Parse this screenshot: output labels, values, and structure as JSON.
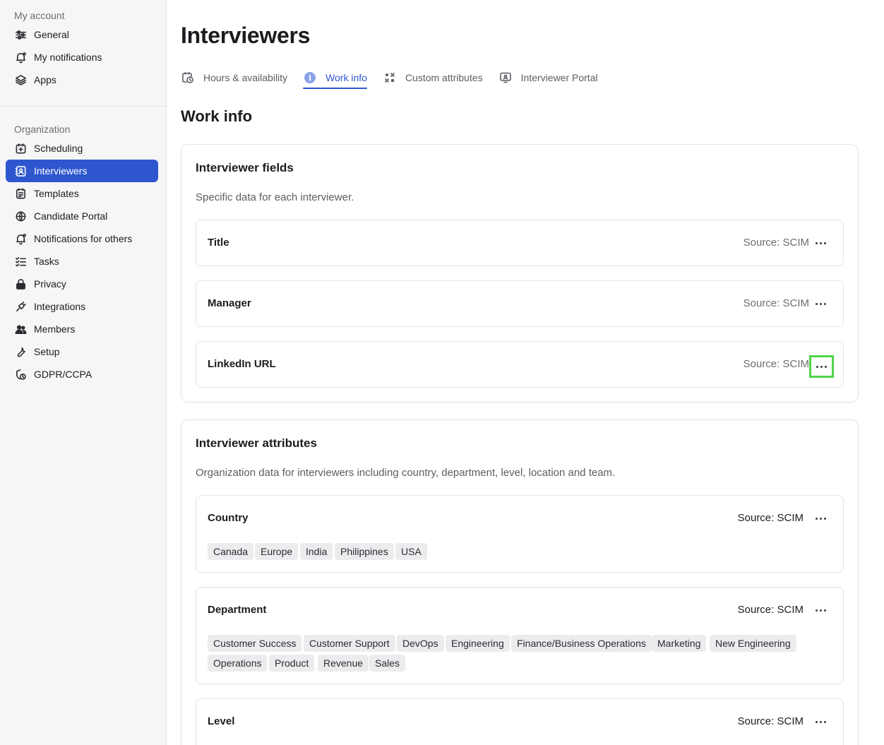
{
  "sidebar": {
    "my_account_title": "My account",
    "my_account_items": [
      {
        "label": "General",
        "icon": "sliders-icon"
      },
      {
        "label": "My notifications",
        "icon": "bell-icon"
      },
      {
        "label": "Apps",
        "icon": "layers-icon"
      }
    ],
    "organization_title": "Organization",
    "organization_items": [
      {
        "label": "Scheduling",
        "icon": "calendar-plus-icon"
      },
      {
        "label": "Interviewers",
        "icon": "contact-card-icon",
        "active": true
      },
      {
        "label": "Templates",
        "icon": "templates-icon"
      },
      {
        "label": "Candidate Portal",
        "icon": "globe-icon"
      },
      {
        "label": "Notifications for others",
        "icon": "bell-icon"
      },
      {
        "label": "Tasks",
        "icon": "checklist-icon"
      },
      {
        "label": "Privacy",
        "icon": "lock-icon"
      },
      {
        "label": "Integrations",
        "icon": "plug-icon"
      },
      {
        "label": "Members",
        "icon": "people-icon"
      },
      {
        "label": "Setup",
        "icon": "wrench-icon"
      },
      {
        "label": "GDPR/CCPA",
        "icon": "shield-clock-icon"
      }
    ]
  },
  "header": {
    "title": "Interviewers",
    "tabs": [
      {
        "label": "Hours & availability",
        "icon": "calendar-clock-icon"
      },
      {
        "label": "Work info",
        "icon": "info-icon",
        "active": true
      },
      {
        "label": "Custom attributes",
        "icon": "shapes-icon"
      },
      {
        "label": "Interviewer Portal",
        "icon": "monitor-user-icon"
      }
    ]
  },
  "main": {
    "section_title": "Work info",
    "fields_card": {
      "title": "Interviewer fields",
      "description": "Specific data for each interviewer.",
      "rows": [
        {
          "label": "Title",
          "source": "Source: SCIM"
        },
        {
          "label": "Manager",
          "source": "Source: SCIM"
        },
        {
          "label": "LinkedIn URL",
          "source": "Source: SCIM"
        }
      ]
    },
    "attributes_card": {
      "title": "Interviewer attributes",
      "description": "Organization data for interviewers including country, department, level, location and team.",
      "rows": [
        {
          "label": "Country",
          "source": "Source: SCIM",
          "tags": [
            "Canada",
            "Europe",
            "India",
            "Philippines",
            "USA"
          ]
        },
        {
          "label": "Department",
          "source": "Source: SCIM",
          "tags": [
            "Customer Success",
            "Customer Support",
            "DevOps",
            "Engineering",
            "Finance/Business Operations",
            "Marketing",
            "New Engineering",
            "Operations",
            "Product",
            "Revenue",
            "Sales"
          ]
        },
        {
          "label": "Level",
          "source": "Source: SCIM"
        }
      ]
    }
  },
  "colors": {
    "accent": "#2e57cf",
    "highlight": "#4fd44a"
  }
}
